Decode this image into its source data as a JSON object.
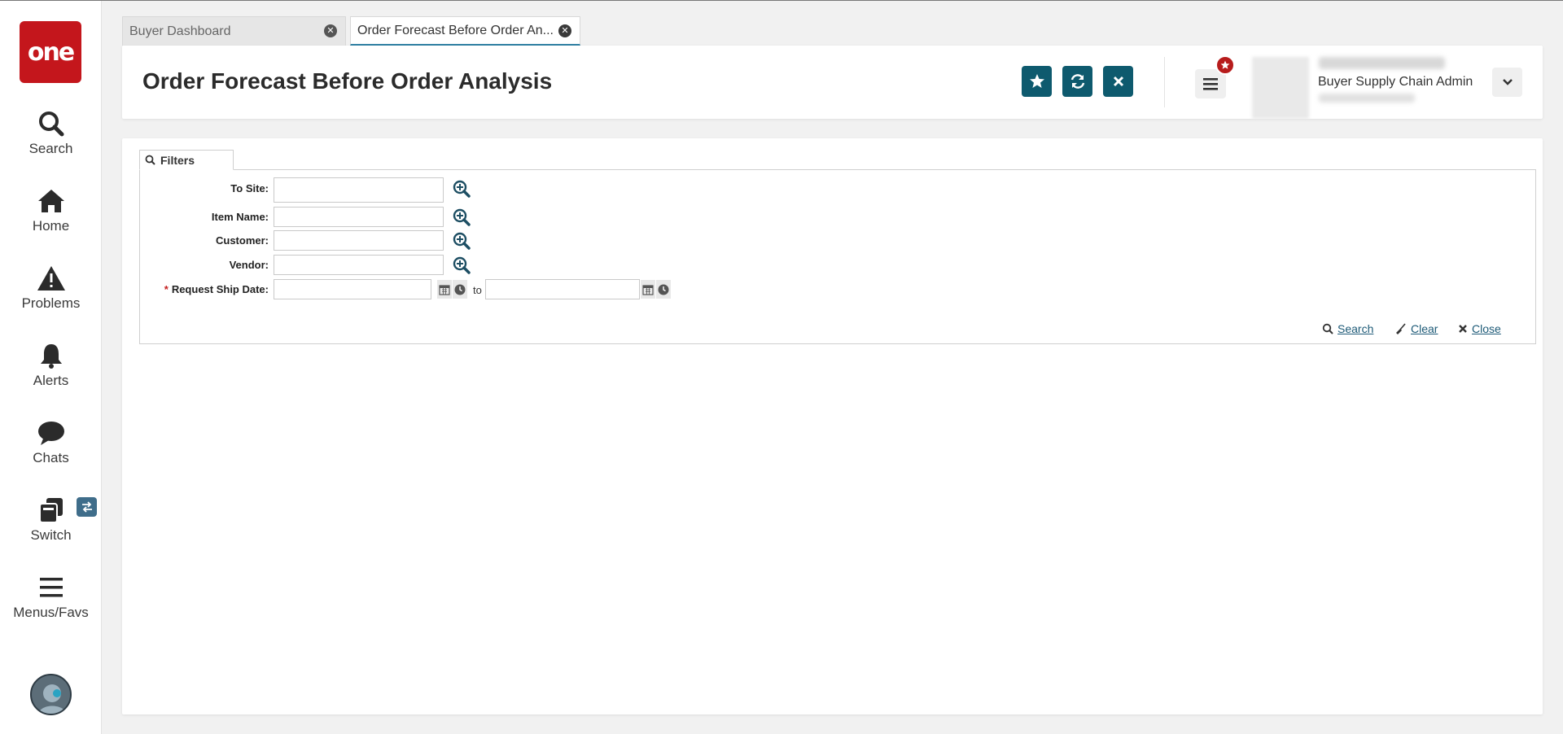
{
  "sidebar": {
    "logo_text": "one",
    "items": [
      {
        "label": "Search",
        "icon": "search-icon"
      },
      {
        "label": "Home",
        "icon": "home-icon"
      },
      {
        "label": "Problems",
        "icon": "warning-icon"
      },
      {
        "label": "Alerts",
        "icon": "bell-icon"
      },
      {
        "label": "Chats",
        "icon": "chat-icon"
      },
      {
        "label": "Switch",
        "icon": "switch-icon"
      },
      {
        "label": "Menus/Favs",
        "icon": "hamburger-icon"
      }
    ]
  },
  "tabs": [
    {
      "label": "Buyer Dashboard",
      "active": false
    },
    {
      "label": "Order Forecast Before Order An...",
      "active": true
    }
  ],
  "header": {
    "title": "Order Forecast Before Order Analysis",
    "user_role": "Buyer Supply Chain Admin"
  },
  "filters": {
    "tab_label": "Filters",
    "fields": {
      "to_site": {
        "label": "To Site:",
        "value": ""
      },
      "item_name": {
        "label": "Item Name:",
        "value": ""
      },
      "customer": {
        "label": "Customer:",
        "value": ""
      },
      "vendor": {
        "label": "Vendor:",
        "value": ""
      },
      "request_ship_date": {
        "label": "Request Ship Date:",
        "required_marker": "*",
        "from": "",
        "to": "",
        "to_label": "to"
      }
    },
    "actions": {
      "search": "Search",
      "clear": "Clear",
      "close": "Close"
    }
  },
  "colors": {
    "brand_red": "#c4161c",
    "accent_teal": "#0e5a6e",
    "link_blue": "#1d5a77",
    "badge_red": "#b71c1c"
  }
}
